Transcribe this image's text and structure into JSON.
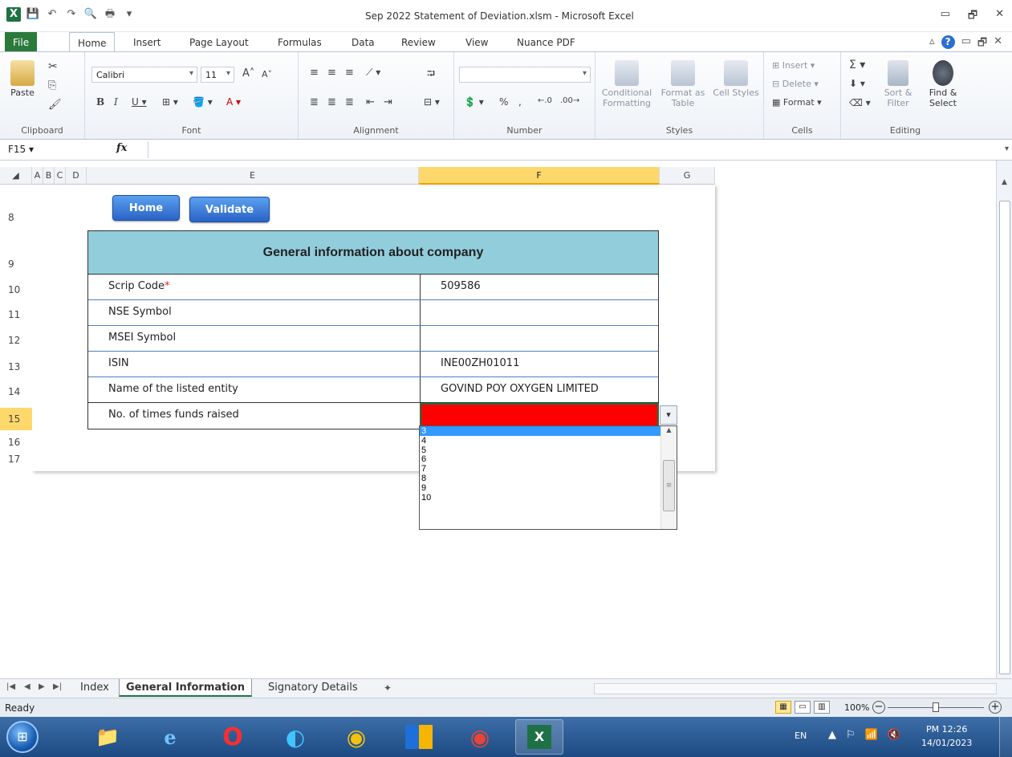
{
  "window": {
    "title": "Sep 2022 Statement of Deviation.xlsm  -  Microsoft Excel",
    "controls": [
      "▭",
      "🗗",
      "✕"
    ]
  },
  "ribbon_tabs": [
    "File",
    "Home",
    "Insert",
    "Page Layout",
    "Formulas",
    "Data",
    "Review",
    "View",
    "Nuance PDF"
  ],
  "ribbon": {
    "clipboard": {
      "paste": "Paste",
      "label": "Clipboard"
    },
    "font": {
      "name": "Calibri",
      "size": "11",
      "label": "Font"
    },
    "alignment": {
      "label": "Alignment"
    },
    "number": {
      "format": "",
      "label": "Number"
    },
    "styles": {
      "conditional": "Conditional Formatting",
      "format_table": "Format as Table",
      "cell_styles": "Cell Styles",
      "label": "Styles"
    },
    "cells": {
      "insert": "Insert",
      "delete": "Delete",
      "format": "Format",
      "label": "Cells"
    },
    "editing": {
      "sort": "Sort & Filter",
      "find": "Find & Select",
      "label": "Editing"
    }
  },
  "formula_bar": {
    "name_box": "F15",
    "fx": "fx",
    "formula": ""
  },
  "columns": [
    "A",
    "B",
    "C",
    "D",
    "E",
    "F",
    "G"
  ],
  "rows": [
    "8",
    "9",
    "10",
    "11",
    "12",
    "13",
    "14",
    "15",
    "16",
    "17"
  ],
  "buttons": {
    "home": "Home",
    "validate": "Validate"
  },
  "table": {
    "title": "General information about company",
    "rows": [
      {
        "label": "Scrip Code",
        "required": "*",
        "value": "509586"
      },
      {
        "label": "NSE Symbol",
        "required": "",
        "value": ""
      },
      {
        "label": "MSEI Symbol",
        "required": "",
        "value": ""
      },
      {
        "label": "ISIN",
        "required": "",
        "value": "INE00ZH01011"
      },
      {
        "label": "Name of the listed entity",
        "required": "",
        "value": "GOVIND POY OXYGEN LIMITED"
      },
      {
        "label": "No. of times funds raised",
        "required": "",
        "value": ""
      }
    ]
  },
  "dropdown": {
    "options": [
      "3",
      "4",
      "5",
      "6",
      "7",
      "8",
      "9",
      "10"
    ],
    "selected": "3"
  },
  "sheet_tabs": [
    "Index",
    "General Information",
    "Signatory Details"
  ],
  "active_sheet": "General Information",
  "status": {
    "text": "Ready",
    "zoom": "100%"
  },
  "clock": {
    "time": "PM 12:26",
    "date": "14/01/2023"
  },
  "tray": {
    "lang": "EN"
  },
  "colors": {
    "header_fill": "#92cddc",
    "required_cell": "#ff0000",
    "button": "#2a63c6",
    "selected_col": "#ffd86b"
  }
}
